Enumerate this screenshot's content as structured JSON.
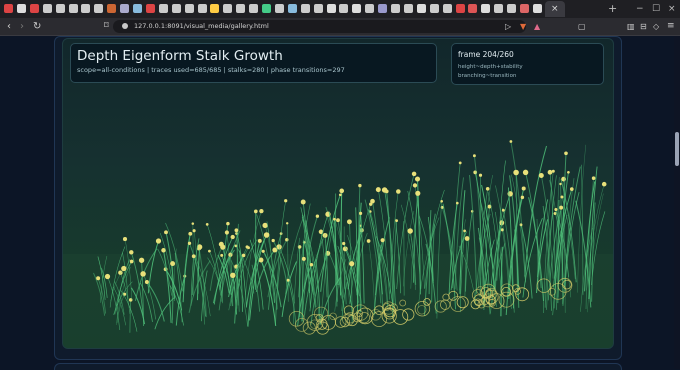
{
  "browser": {
    "url": "127.0.0.1:8091/visual_media/gallery.html",
    "tab_icons": [
      "#d44",
      "#ddd",
      "#d44",
      "#ccc",
      "#ccc",
      "#ccc",
      "#ccc",
      "#ccc",
      "#c63",
      "#aac",
      "#8bd",
      "#d44",
      "#ccc",
      "#ccc",
      "#ccc",
      "#ccc",
      "#fc4",
      "#ccc",
      "#ccc",
      "#ccc",
      "#4c8",
      "#ccc",
      "#8bd",
      "#ccc",
      "#ccc",
      "#ddd",
      "#ccc",
      "#ddd",
      "#ccc",
      "#99c",
      "#ccc",
      "#ccc",
      "#ddd",
      "#ccc",
      "#ccc",
      "#d44",
      "#d55",
      "#ddd",
      "#ccc",
      "#ccc",
      "#d66",
      "#ddd"
    ],
    "active_tab_close": "×",
    "new_tab": "+",
    "window_controls": [
      "−",
      "☐",
      "×"
    ]
  },
  "viz": {
    "title": "Depth Eigenform Stalk Growth",
    "subtitle": "scope=all-conditions | traces used=685/685 | stalks=280 | phase transitions=297",
    "frame_label": "frame 204/260",
    "frame_lines": [
      "height~depth+stability",
      "branching~transition"
    ],
    "colors": {
      "stalk": "#4fc07a",
      "bud": "#e8e07a",
      "ring": "#d8cf6a"
    }
  }
}
